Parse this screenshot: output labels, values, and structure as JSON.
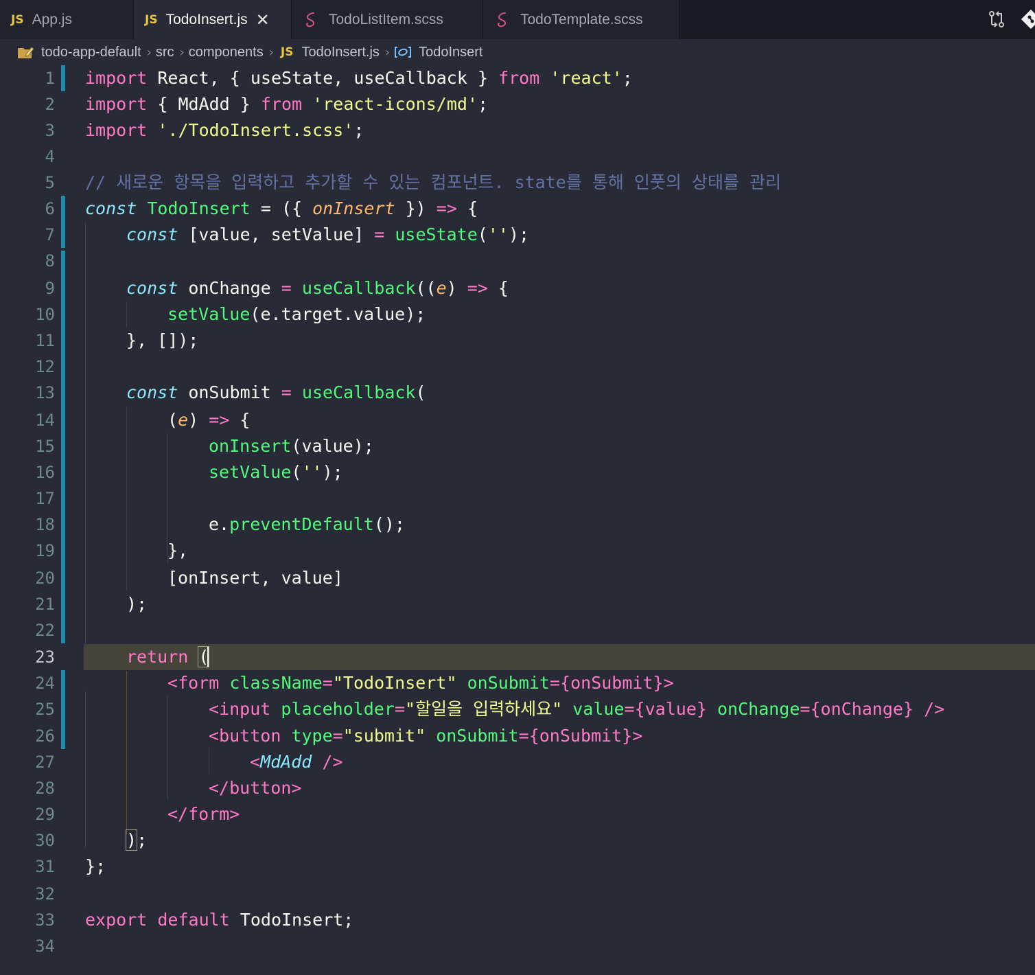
{
  "tabs": [
    {
      "label": "App.js",
      "badge": "JS",
      "type": "js",
      "active": false
    },
    {
      "label": "TodoInsert.js",
      "badge": "JS",
      "type": "js",
      "active": true
    },
    {
      "label": "TodoListItem.scss",
      "badge": "",
      "type": "scss",
      "active": false
    },
    {
      "label": "TodoTemplate.scss",
      "badge": "",
      "type": "scss",
      "active": false
    }
  ],
  "tab_close_glyph": "✕",
  "breadcrumb": {
    "folder": "todo-app-default",
    "src": "src",
    "components": "components",
    "file_badge": "JS",
    "file": "TodoInsert.js",
    "symbol": "TodoInsert"
  },
  "line_numbers": [
    "1",
    "2",
    "3",
    "4",
    "5",
    "6",
    "7",
    "8",
    "9",
    "10",
    "11",
    "12",
    "13",
    "14",
    "15",
    "16",
    "17",
    "18",
    "19",
    "20",
    "21",
    "22",
    "23",
    "24",
    "25",
    "26",
    "27",
    "28",
    "29",
    "30",
    "31",
    "32",
    "33",
    "34"
  ],
  "current_line": 23,
  "code": {
    "l1": [
      [
        "k",
        "import"
      ],
      [
        "",
        "React, { useState, useCallback } "
      ],
      [
        "k",
        "from"
      ],
      [
        "",
        ""
      ],
      [
        "s",
        "'react'"
      ],
      [
        "",
        ";"
      ]
    ],
    "l2": [
      [
        "k",
        "import"
      ],
      [
        "",
        "{ MdAdd } "
      ],
      [
        "k",
        "from"
      ],
      [
        "",
        ""
      ],
      [
        "s",
        "'react-icons/md'"
      ],
      [
        "",
        ";"
      ]
    ],
    "l3": [
      [
        "k",
        "import"
      ],
      [
        "",
        ""
      ],
      [
        "s",
        "'./TodoInsert.scss'"
      ],
      [
        "",
        ";"
      ]
    ],
    "l5": "// 새로운 항목을 입력하고 추가할 수 있는 컴포넌트. state를 통해 인풋의 상태를 관리",
    "l6_const": "const",
    "l6_name": "TodoInsert",
    "l6_eq": " = ({ ",
    "l6_param": "onInsert",
    "l6_rest": " }) ",
    "l6_arrow": "=>",
    "l6_end": " {",
    "l7": "const [value, setValue] = useState('');",
    "l9": "const onChange = useCallback((e) => {",
    "l10": "setValue(e.target.value);",
    "l11": "}, []);",
    "l13": "const onSubmit = useCallback(",
    "l14": "(e) => {",
    "l15": "onInsert(value);",
    "l16": "setValue('');",
    "l18": "e.preventDefault();",
    "l19": "},",
    "l20": "[onInsert, value]",
    "l21": ");",
    "l23": "return (",
    "l24": "<form className=\"TodoInsert\" onSubmit={onSubmit}>",
    "l25": "<input placeholder=\"할일을 입력하세요\" value={value} onChange={onChange} />",
    "l26": "<button type=\"submit\" onSubmit={onSubmit}>",
    "l27": "<MdAdd />",
    "l28": "</button>",
    "l29": "</form>",
    "l30": ");",
    "l31": "};",
    "l33": "export default TodoInsert;"
  },
  "colors": {
    "background": "#282a36",
    "keyword": "#ff79c6",
    "string": "#f1fa8c",
    "function": "#50fa7b",
    "comment": "#6272a4",
    "storage": "#8be9fd",
    "parameter": "#ffb86c",
    "git_modified": "#1e8ca8"
  },
  "icons": [
    "folder-icon",
    "compare-changes-icon",
    "git-icon",
    "symbol-class-icon",
    "scss-icon"
  ]
}
